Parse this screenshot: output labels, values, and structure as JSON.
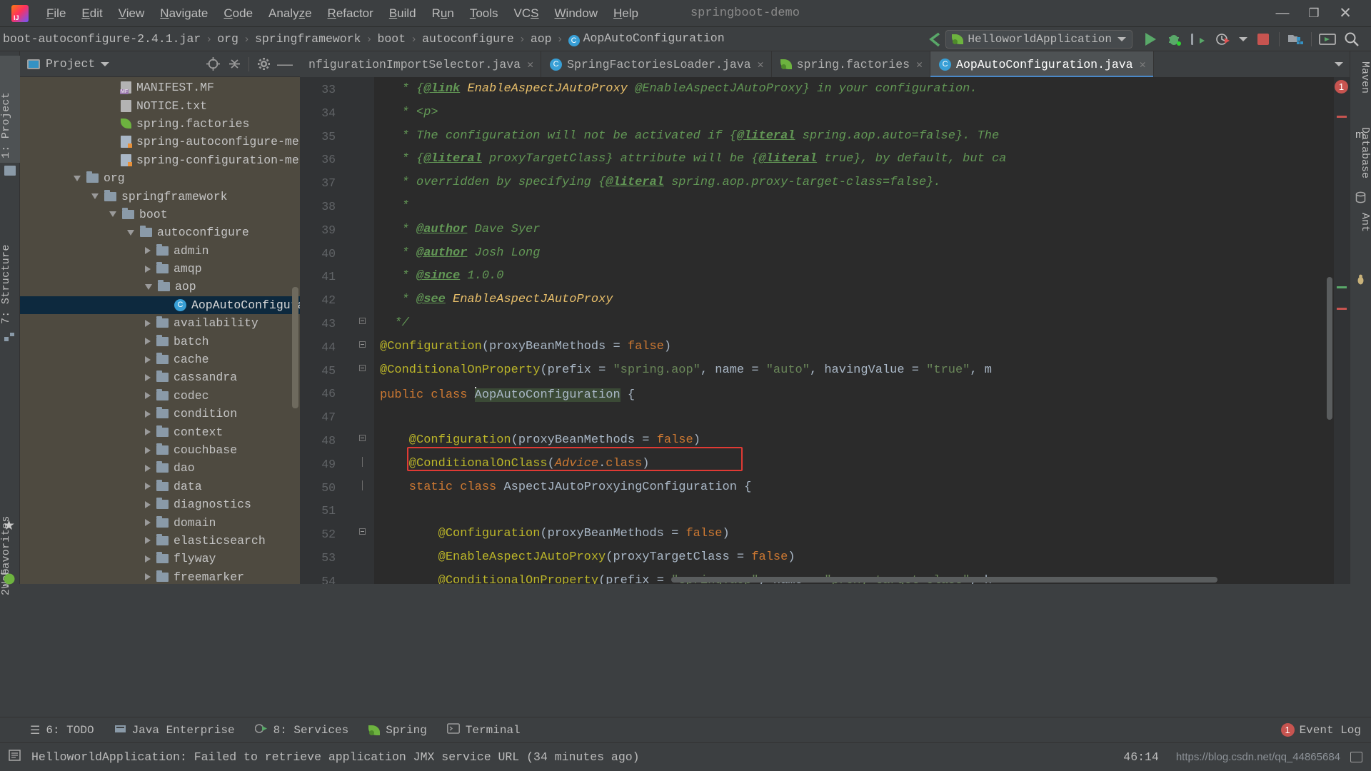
{
  "window": {
    "project_title": "springboot-demo",
    "logo": "intellij-idea-logo",
    "minimize": "—",
    "maximize": "❐",
    "close": "✕"
  },
  "menubar": {
    "items": [
      {
        "label": "File",
        "mnemonic": "F"
      },
      {
        "label": "Edit",
        "mnemonic": "E"
      },
      {
        "label": "View",
        "mnemonic": "V"
      },
      {
        "label": "Navigate",
        "mnemonic": "N"
      },
      {
        "label": "Code",
        "mnemonic": "C"
      },
      {
        "label": "Analyze",
        "mnemonic": "z"
      },
      {
        "label": "Refactor",
        "mnemonic": "R"
      },
      {
        "label": "Build",
        "mnemonic": "B"
      },
      {
        "label": "Run",
        "mnemonic": "u"
      },
      {
        "label": "Tools",
        "mnemonic": "T"
      },
      {
        "label": "VCS",
        "mnemonic": "S"
      },
      {
        "label": "Window",
        "mnemonic": "W"
      },
      {
        "label": "Help",
        "mnemonic": "H"
      }
    ]
  },
  "navbar": {
    "breadcrumbs": [
      {
        "label": "boot-autoconfigure-2.4.1.jar",
        "icon": "jar-icon"
      },
      {
        "label": "org",
        "icon": "package-icon"
      },
      {
        "label": "springframework",
        "icon": "package-icon"
      },
      {
        "label": "boot",
        "icon": "package-icon"
      },
      {
        "label": "autoconfigure",
        "icon": "package-icon"
      },
      {
        "label": "aop",
        "icon": "package-icon"
      },
      {
        "label": "AopAutoConfiguration",
        "icon": "class-icon"
      }
    ],
    "separator": "›",
    "run_config": {
      "name": "HelloworldApplication",
      "icon": "spring-boot-icon",
      "dropdown": "chevron-down-icon"
    },
    "buttons": [
      {
        "name": "run-button",
        "icon": "play-icon"
      },
      {
        "name": "debug-button",
        "icon": "bug-icon"
      },
      {
        "name": "run-with-coverage-button",
        "icon": "coverage-icon"
      },
      {
        "name": "profiler-button",
        "icon": "profiler-icon"
      },
      {
        "name": "stop-button",
        "icon": "stop-icon"
      },
      {
        "name": "project-structure-button",
        "icon": "project-structure-icon"
      },
      {
        "name": "updating-button",
        "icon": "update-icon"
      },
      {
        "name": "search-everywhere-button",
        "icon": "search-icon"
      }
    ]
  },
  "left_strip": {
    "tabs": [
      {
        "label": "1: Project",
        "mnemonic": "1",
        "icon": "project-icon",
        "active": true
      },
      {
        "label": "7: Structure",
        "mnemonic": "7",
        "icon": "structure-icon",
        "active": false
      },
      {
        "label": "2: Favorites",
        "mnemonic": "2",
        "icon": "star-icon",
        "active": false
      },
      {
        "label": "Web",
        "mnemonic": "",
        "icon": "web-icon",
        "active": false
      }
    ]
  },
  "right_strip": {
    "tabs": [
      {
        "label": "Maven",
        "icon": "maven-icon"
      },
      {
        "label": "Database",
        "icon": "database-icon"
      },
      {
        "label": "Ant",
        "icon": "ant-icon"
      }
    ]
  },
  "project_panel": {
    "title": "Project",
    "dropdown": "chevron-down-icon",
    "toolbar": [
      {
        "name": "locate-file-button",
        "icon": "target-icon"
      },
      {
        "name": "collapse-all-button",
        "icon": "collapse-all-icon"
      },
      {
        "name": "settings-button",
        "icon": "gear-icon"
      },
      {
        "name": "hide-button",
        "icon": "minimize-icon"
      }
    ],
    "tree": [
      {
        "label": "MANIFEST.MF",
        "indent": 5,
        "arrow": "none",
        "icon": "manifest-file-icon",
        "selected": false
      },
      {
        "label": "NOTICE.txt",
        "indent": 5,
        "arrow": "none",
        "icon": "text-file-icon",
        "selected": false
      },
      {
        "label": "spring.factories",
        "indent": 5,
        "arrow": "none",
        "icon": "spring-file-icon",
        "selected": false
      },
      {
        "label": "spring-autoconfigure-metadat",
        "indent": 5,
        "arrow": "none",
        "icon": "properties-file-icon",
        "selected": false
      },
      {
        "label": "spring-configuration-metadat",
        "indent": 5,
        "arrow": "none",
        "icon": "json-file-icon",
        "selected": false
      },
      {
        "label": "org",
        "indent": 3,
        "arrow": "down",
        "icon": "package-icon",
        "selected": false
      },
      {
        "label": "springframework",
        "indent": 4,
        "arrow": "down",
        "icon": "package-icon",
        "selected": false
      },
      {
        "label": "boot",
        "indent": 5,
        "arrow": "down",
        "icon": "package-icon",
        "selected": false
      },
      {
        "label": "autoconfigure",
        "indent": 6,
        "arrow": "down",
        "icon": "package-icon",
        "selected": false
      },
      {
        "label": "admin",
        "indent": 7,
        "arrow": "right",
        "icon": "package-icon",
        "selected": false
      },
      {
        "label": "amqp",
        "indent": 7,
        "arrow": "right",
        "icon": "package-icon",
        "selected": false
      },
      {
        "label": "aop",
        "indent": 7,
        "arrow": "down",
        "icon": "package-icon",
        "selected": false
      },
      {
        "label": "AopAutoConfigurat",
        "indent": 8,
        "arrow": "none",
        "icon": "class-icon",
        "selected": true
      },
      {
        "label": "availability",
        "indent": 7,
        "arrow": "right",
        "icon": "package-icon",
        "selected": false
      },
      {
        "label": "batch",
        "indent": 7,
        "arrow": "right",
        "icon": "package-icon",
        "selected": false
      },
      {
        "label": "cache",
        "indent": 7,
        "arrow": "right",
        "icon": "package-icon",
        "selected": false
      },
      {
        "label": "cassandra",
        "indent": 7,
        "arrow": "right",
        "icon": "package-icon",
        "selected": false
      },
      {
        "label": "codec",
        "indent": 7,
        "arrow": "right",
        "icon": "package-icon",
        "selected": false
      },
      {
        "label": "condition",
        "indent": 7,
        "arrow": "right",
        "icon": "package-icon",
        "selected": false
      },
      {
        "label": "context",
        "indent": 7,
        "arrow": "right",
        "icon": "package-icon",
        "selected": false
      },
      {
        "label": "couchbase",
        "indent": 7,
        "arrow": "right",
        "icon": "package-icon",
        "selected": false
      },
      {
        "label": "dao",
        "indent": 7,
        "arrow": "right",
        "icon": "package-icon",
        "selected": false
      },
      {
        "label": "data",
        "indent": 7,
        "arrow": "right",
        "icon": "package-icon",
        "selected": false
      },
      {
        "label": "diagnostics",
        "indent": 7,
        "arrow": "right",
        "icon": "package-icon",
        "selected": false
      },
      {
        "label": "domain",
        "indent": 7,
        "arrow": "right",
        "icon": "package-icon",
        "selected": false
      },
      {
        "label": "elasticsearch",
        "indent": 7,
        "arrow": "right",
        "icon": "package-icon",
        "selected": false
      },
      {
        "label": "flyway",
        "indent": 7,
        "arrow": "right",
        "icon": "package-icon",
        "selected": false
      },
      {
        "label": "freemarker",
        "indent": 7,
        "arrow": "right",
        "icon": "package-icon",
        "selected": false
      }
    ]
  },
  "editor_tabs": {
    "tabs": [
      {
        "label": "nfigurationImportSelector.java",
        "icon": "none",
        "close": "✕",
        "active": false
      },
      {
        "label": "SpringFactoriesLoader.java",
        "icon": "class-icon",
        "close": "✕",
        "active": false
      },
      {
        "label": "spring.factories",
        "icon": "spring-file-icon",
        "close": "✕",
        "active": false
      },
      {
        "label": "AopAutoConfiguration.java",
        "icon": "class-icon",
        "close": "✕",
        "active": true
      }
    ],
    "overflow": "chevron-down-icon"
  },
  "editor": {
    "first_line": 33,
    "error_count": "1",
    "lines": [
      {
        "n": 33,
        "fold": "none",
        "tokens": [
          {
            "t": "   * ",
            "c": "doc"
          },
          {
            "t": "{",
            "c": "doc"
          },
          {
            "t": "@link",
            "c": "doctag"
          },
          {
            "t": " ",
            "c": "doc"
          },
          {
            "t": "EnableAspectJAutoProxy",
            "c": "doclink"
          },
          {
            "t": " ",
            "c": "doc"
          },
          {
            "t": "@EnableAspectJAutoProxy} in your configuration.",
            "c": "doc"
          }
        ]
      },
      {
        "n": 34,
        "fold": "none",
        "tokens": [
          {
            "t": "   * <p>",
            "c": "doc"
          }
        ]
      },
      {
        "n": 35,
        "fold": "none",
        "tokens": [
          {
            "t": "   * The configuration will not be activated if {",
            "c": "doc"
          },
          {
            "t": "@literal",
            "c": "doctag"
          },
          {
            "t": " spring.aop.auto=false}. The",
            "c": "doc"
          }
        ]
      },
      {
        "n": 36,
        "fold": "none",
        "tokens": [
          {
            "t": "   * {",
            "c": "doc"
          },
          {
            "t": "@literal",
            "c": "doctag"
          },
          {
            "t": " proxyTargetClass} attribute will be {",
            "c": "doc"
          },
          {
            "t": "@literal",
            "c": "doctag"
          },
          {
            "t": " true}, by default, but ca",
            "c": "doc"
          }
        ]
      },
      {
        "n": 37,
        "fold": "none",
        "tokens": [
          {
            "t": "   * overridden by specifying {",
            "c": "doc"
          },
          {
            "t": "@literal",
            "c": "doctag"
          },
          {
            "t": " spring.aop.proxy-target-class=false}.",
            "c": "doc"
          }
        ]
      },
      {
        "n": 38,
        "fold": "none",
        "tokens": [
          {
            "t": "   *",
            "c": "doc"
          }
        ]
      },
      {
        "n": 39,
        "fold": "none",
        "tokens": [
          {
            "t": "   * ",
            "c": "doc"
          },
          {
            "t": "@author",
            "c": "doctag"
          },
          {
            "t": " Dave Syer",
            "c": "doc"
          }
        ]
      },
      {
        "n": 40,
        "fold": "none",
        "tokens": [
          {
            "t": "   * ",
            "c": "doc"
          },
          {
            "t": "@author",
            "c": "doctag"
          },
          {
            "t": " Josh Long",
            "c": "doc"
          }
        ]
      },
      {
        "n": 41,
        "fold": "none",
        "tokens": [
          {
            "t": "   * ",
            "c": "doc"
          },
          {
            "t": "@since",
            "c": "doctag"
          },
          {
            "t": " 1.0.0",
            "c": "doc"
          }
        ]
      },
      {
        "n": 42,
        "fold": "none",
        "tokens": [
          {
            "t": "   * ",
            "c": "doc"
          },
          {
            "t": "@see",
            "c": "doctag"
          },
          {
            "t": " ",
            "c": "doc"
          },
          {
            "t": "EnableAspectJAutoProxy",
            "c": "doclink"
          }
        ]
      },
      {
        "n": 43,
        "fold": "end",
        "tokens": [
          {
            "t": "  */",
            "c": "doc"
          }
        ]
      },
      {
        "n": 44,
        "fold": "start",
        "tokens": [
          {
            "t": "@Configuration",
            "c": "anno"
          },
          {
            "t": "(",
            "c": "txt"
          },
          {
            "t": "proxyBeanMethods ",
            "c": "txt"
          },
          {
            "t": "= ",
            "c": "txt"
          },
          {
            "t": "false",
            "c": "kw"
          },
          {
            "t": ")",
            "c": "txt"
          }
        ]
      },
      {
        "n": 45,
        "fold": "start",
        "tokens": [
          {
            "t": "@ConditionalOnProperty",
            "c": "anno"
          },
          {
            "t": "(",
            "c": "txt"
          },
          {
            "t": "prefix ",
            "c": "txt"
          },
          {
            "t": "= ",
            "c": "txt"
          },
          {
            "t": "\"spring.aop\"",
            "c": "str"
          },
          {
            "t": ", ",
            "c": "txt"
          },
          {
            "t": "name ",
            "c": "txt"
          },
          {
            "t": "= ",
            "c": "txt"
          },
          {
            "t": "\"auto\"",
            "c": "str"
          },
          {
            "t": ", ",
            "c": "txt"
          },
          {
            "t": "havingValue ",
            "c": "txt"
          },
          {
            "t": "= ",
            "c": "txt"
          },
          {
            "t": "\"true\"",
            "c": "str"
          },
          {
            "t": ", m",
            "c": "txt"
          }
        ]
      },
      {
        "n": 46,
        "fold": "none",
        "tokens": [
          {
            "t": "public ",
            "c": "kw"
          },
          {
            "t": "class ",
            "c": "kw"
          },
          {
            "t": "AopAutoConfiguration",
            "c": "cls hl-ident"
          },
          {
            "t": " {",
            "c": "txt"
          }
        ]
      },
      {
        "n": 47,
        "fold": "none",
        "tokens": []
      },
      {
        "n": 48,
        "fold": "start",
        "tokens": [
          {
            "t": "    @Configuration",
            "c": "anno"
          },
          {
            "t": "(",
            "c": "txt"
          },
          {
            "t": "proxyBeanMethods ",
            "c": "txt"
          },
          {
            "t": "= ",
            "c": "txt"
          },
          {
            "t": "false",
            "c": "kw"
          },
          {
            "t": ")",
            "c": "txt"
          }
        ]
      },
      {
        "n": 49,
        "fold": "mid",
        "tokens": [
          {
            "t": "    @ConditionalOnClass",
            "c": "anno"
          },
          {
            "t": "(",
            "c": "txt"
          },
          {
            "t": "Advice",
            "c": "docparam"
          },
          {
            "t": ".",
            "c": "txt"
          },
          {
            "t": "class",
            "c": "kw"
          },
          {
            "t": ")",
            "c": "txt"
          }
        ]
      },
      {
        "n": 50,
        "fold": "mid",
        "tokens": [
          {
            "t": "    static ",
            "c": "kw"
          },
          {
            "t": "class ",
            "c": "kw"
          },
          {
            "t": "AspectJAutoProxyingConfiguration",
            "c": "cls"
          },
          {
            "t": " {",
            "c": "txt"
          }
        ]
      },
      {
        "n": 51,
        "fold": "none",
        "tokens": []
      },
      {
        "n": 52,
        "fold": "start",
        "tokens": [
          {
            "t": "        @Configuration",
            "c": "anno"
          },
          {
            "t": "(",
            "c": "txt"
          },
          {
            "t": "proxyBeanMethods ",
            "c": "txt"
          },
          {
            "t": "= ",
            "c": "txt"
          },
          {
            "t": "false",
            "c": "kw"
          },
          {
            "t": ")",
            "c": "txt"
          }
        ]
      },
      {
        "n": 53,
        "fold": "none",
        "tokens": [
          {
            "t": "        @EnableAspectJAutoProxy",
            "c": "anno"
          },
          {
            "t": "(",
            "c": "txt"
          },
          {
            "t": "proxyTargetClass ",
            "c": "txt"
          },
          {
            "t": "= ",
            "c": "txt"
          },
          {
            "t": "false",
            "c": "kw"
          },
          {
            "t": ")",
            "c": "txt"
          }
        ]
      },
      {
        "n": 54,
        "fold": "none",
        "tokens": [
          {
            "t": "        @ConditionalOnProperty",
            "c": "anno"
          },
          {
            "t": "(",
            "c": "txt"
          },
          {
            "t": "prefix ",
            "c": "txt"
          },
          {
            "t": "= ",
            "c": "txt"
          },
          {
            "t": "\"spring.aop\"",
            "c": "str"
          },
          {
            "t": ", ",
            "c": "txt"
          },
          {
            "t": "name ",
            "c": "txt"
          },
          {
            "t": "= ",
            "c": "txt"
          },
          {
            "t": "\"proxy-target-class\"",
            "c": "str"
          },
          {
            "t": ", h",
            "c": "txt"
          }
        ]
      }
    ]
  },
  "bottom_bar": {
    "tabs": [
      {
        "label": "6: TODO",
        "mnemonic": "6",
        "icon": "todo-icon"
      },
      {
        "label": "Java Enterprise",
        "mnemonic": "",
        "icon": "java-enterprise-icon"
      },
      {
        "label": "8: Services",
        "mnemonic": "8",
        "icon": "services-icon"
      },
      {
        "label": "Spring",
        "mnemonic": "",
        "icon": "spring-leaf-icon"
      },
      {
        "label": "Terminal",
        "mnemonic": "",
        "icon": "terminal-icon"
      }
    ],
    "event_log": {
      "label": "Event Log",
      "count": "1",
      "icon": "event-log-icon"
    }
  },
  "status_bar": {
    "message": "HelloworldApplication: Failed to retrieve application JMX service URL (34 minutes ago)",
    "caret_position": "46:14",
    "watermark": "https://blog.csdn.net/qq_44865684",
    "icons": [
      "document-icon",
      "memory-icon"
    ]
  }
}
